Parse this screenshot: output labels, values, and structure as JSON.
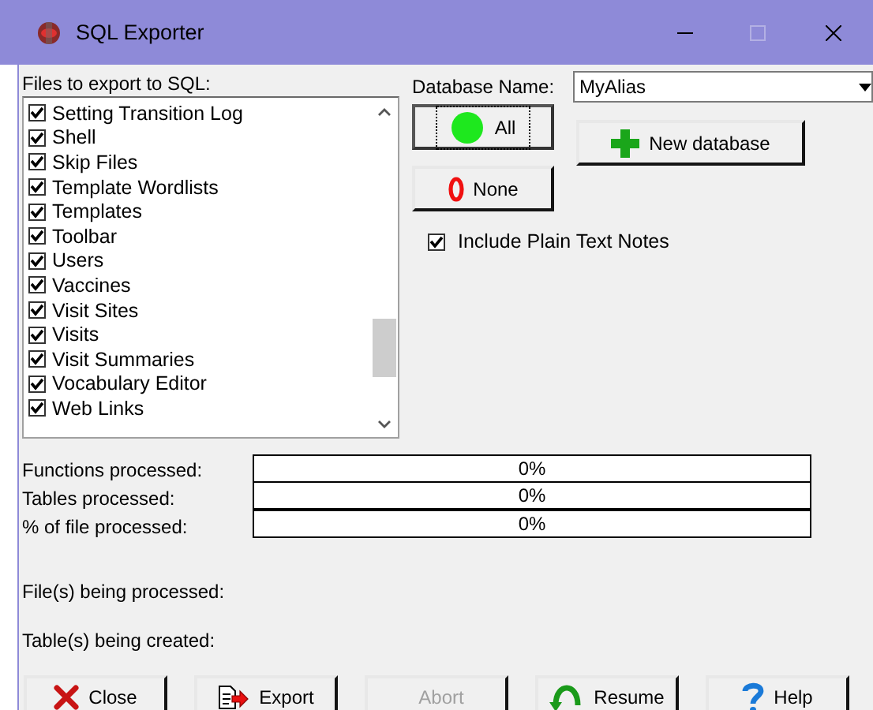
{
  "window": {
    "title": "SQL Exporter",
    "controls": [
      {
        "kind": "minimize",
        "disabled": false
      },
      {
        "kind": "maximize",
        "disabled": true
      },
      {
        "kind": "close",
        "disabled": false
      }
    ]
  },
  "files": {
    "label": "Files to export to SQL:",
    "items": [
      {
        "label": "Setting Transition Log",
        "checked": true
      },
      {
        "label": "Shell",
        "checked": true
      },
      {
        "label": "Skip Files",
        "checked": true
      },
      {
        "label": "Template Wordlists",
        "checked": true
      },
      {
        "label": "Templates",
        "checked": true
      },
      {
        "label": "Toolbar",
        "checked": true
      },
      {
        "label": "Users",
        "checked": true
      },
      {
        "label": "Vaccines",
        "checked": true
      },
      {
        "label": "Visit Sites",
        "checked": true
      },
      {
        "label": "Visits",
        "checked": true
      },
      {
        "label": "Visit Summaries",
        "checked": true
      },
      {
        "label": "Vocabulary Editor",
        "checked": true
      },
      {
        "label": "Web Links",
        "checked": true
      }
    ]
  },
  "database": {
    "label": "Database Name:",
    "value": "MyAlias"
  },
  "select_buttons": [
    {
      "label": "All",
      "kind": "all",
      "focused": true
    },
    {
      "label": "None",
      "kind": "none",
      "focused": false
    }
  ],
  "new_database_button": {
    "label": "New database"
  },
  "include_plain_text_notes": {
    "label": "Include Plain Text Notes",
    "checked": true
  },
  "progress": [
    {
      "label": "Functions processed:",
      "level": 0,
      "reading": "0%"
    },
    {
      "label": "Tables processed:",
      "level": 0,
      "reading": "0%"
    },
    {
      "label": "% of file processed:",
      "level": 0,
      "reading": "0%"
    }
  ],
  "status": [
    {
      "label": "File(s) being processed:"
    },
    {
      "label": "Table(s) being created:"
    }
  ],
  "buttons": [
    {
      "label": "Close",
      "kind": "close",
      "disabled": false
    },
    {
      "label": "Export",
      "kind": "export",
      "disabled": false
    },
    {
      "label": "Abort",
      "kind": "abort",
      "disabled": true
    },
    {
      "label": "Resume",
      "kind": "resume",
      "disabled": false
    },
    {
      "label": "Help",
      "kind": "help",
      "disabled": false
    }
  ]
}
